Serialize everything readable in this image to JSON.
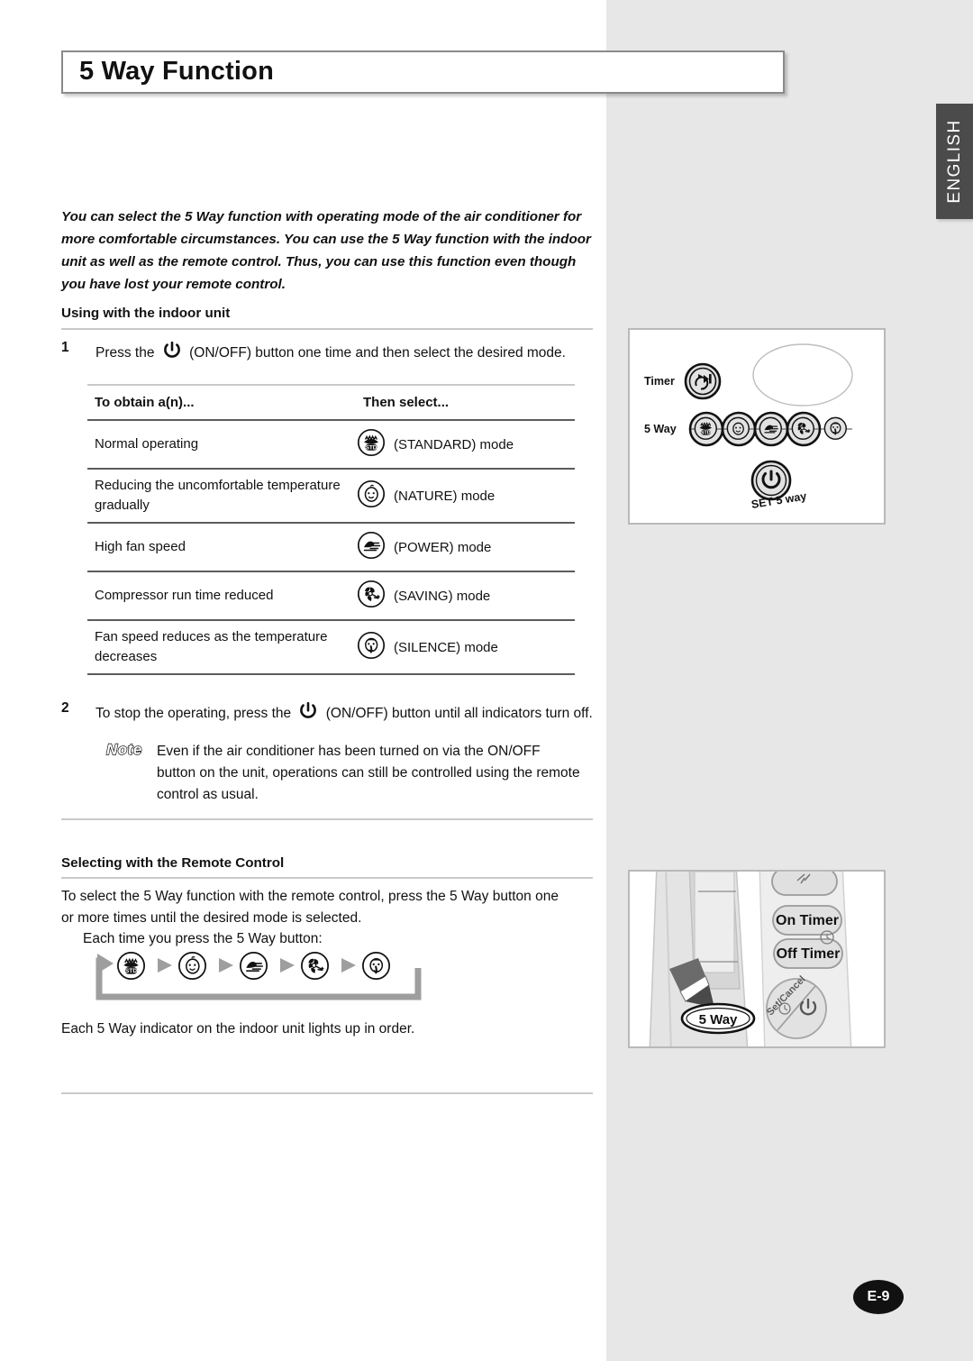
{
  "sidebar": {
    "language_tab": "ENGLISH"
  },
  "header": {
    "title": "5 Way Function"
  },
  "intro": {
    "paragraph": "You can select the 5 Way function with operating mode of the air conditioner for more comfortable circumstances. You can use the 5 Way function with the indoor unit as well as the remote control. Thus, you can use this function even though you have lost your remote control."
  },
  "sections": {
    "indoor_unit_heading": "Using with the indoor unit",
    "remote_control_heading": "Selecting with the Remote Control"
  },
  "steps": [
    {
      "number": "1",
      "text_before_icon": "Press the",
      "icon": "power-on-off-icon",
      "text_after_icon": "(ON/OFF) button one time and then select the desired mode."
    },
    {
      "number": "2",
      "text_before_icon": "To stop the operating, press the",
      "icon": "power-on-off-icon",
      "text_after_icon": "(ON/OFF) button until all indicators turn off."
    }
  ],
  "table": {
    "headers": [
      "To obtain a(n)...",
      "Then select..."
    ],
    "rows": [
      {
        "description": "Normal operating",
        "icon": "standard-mode-icon",
        "mode_label": "(STANDARD) mode"
      },
      {
        "description": "Reducing the uncomfortable temperature gradually",
        "icon": "nature-mode-icon",
        "mode_label": "(NATURE) mode"
      },
      {
        "description": "High fan speed",
        "icon": "power-mode-icon",
        "mode_label": "(POWER) mode"
      },
      {
        "description": "Compressor run time reduced",
        "icon": "saving-mode-icon",
        "mode_label": "(SAVING) mode"
      },
      {
        "description": "Fan speed reduces as the temperature decreases",
        "icon": "silence-mode-icon",
        "mode_label": "(SILENCE) mode"
      }
    ]
  },
  "note": {
    "badge": "Note",
    "text": "Even if the air conditioner has been turned on via the ON/OFF button on the unit, operations can still be controlled using the remote control as usual."
  },
  "remote_section": {
    "paragraph": "To select the 5 Way function with the remote control, press the 5 Way button one or more times until the desired mode is selected.",
    "each_press_label": "Each time you press the 5 Way button:",
    "flow_icons": [
      "standard-mode-icon",
      "nature-mode-icon",
      "power-mode-icon",
      "saving-mode-icon",
      "silence-mode-icon"
    ],
    "order_text": "Each 5 Way indicator on the indoor unit lights up in order."
  },
  "figures": {
    "indoor_unit": {
      "timer_label": "Timer",
      "five_way_label": "5 Way",
      "set_label": "SET 5 way",
      "indicator_icons": [
        "standard-mode-icon",
        "nature-mode-icon",
        "power-mode-icon",
        "saving-mode-icon",
        "silence-mode-icon"
      ]
    },
    "remote_control": {
      "on_timer_label": "On Timer",
      "off_timer_label": "Off Timer",
      "set_cancel_label": "Set/Cancel",
      "five_way_button_label": "5 Way"
    }
  },
  "footer": {
    "page_number": "E-9"
  },
  "colors": {
    "page_background": "#e7e7e7",
    "content_background": "#ffffff",
    "tab_background": "#4b4b4b",
    "rule": "#5c5c5c",
    "figure_border": "#b9b9b9",
    "flow_arrow": "#9e9e9e"
  }
}
